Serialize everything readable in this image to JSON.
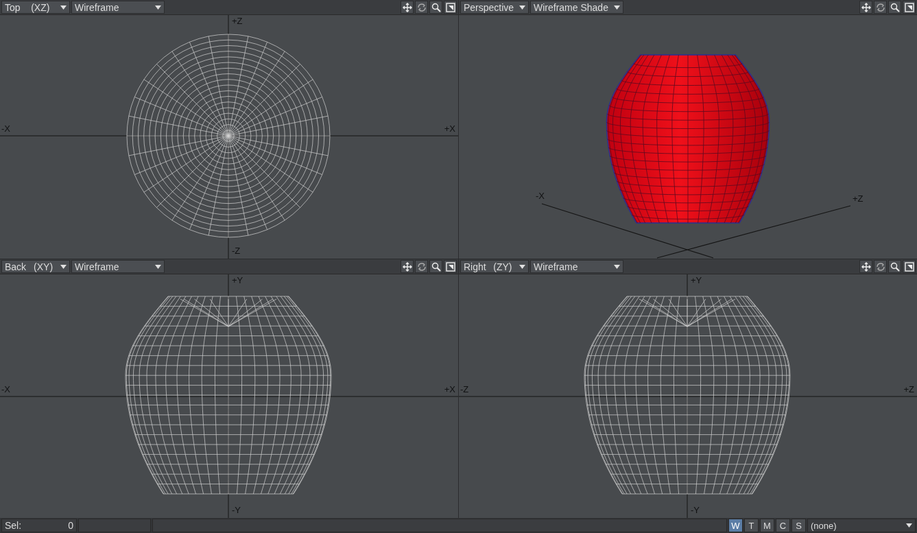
{
  "viewports": [
    {
      "view": "Top",
      "axes": "(XZ)",
      "mode": "Wireframe",
      "kind": "top",
      "axis_labels": [
        "+Z",
        "-Z",
        "-X",
        "+X"
      ]
    },
    {
      "view": "Perspective",
      "mode": "Wireframe Shade",
      "kind": "perspective",
      "axis_labels": [
        "-X",
        "+Z"
      ]
    },
    {
      "view": "Back",
      "axes": "(XY)",
      "mode": "Wireframe",
      "kind": "side",
      "axis_labels": [
        "+Y",
        "-Y",
        "-X",
        "+X"
      ]
    },
    {
      "view": "Right",
      "axes": "(ZY)",
      "mode": "Wireframe",
      "kind": "side",
      "axis_labels": [
        "+Y",
        "-Y",
        "-Z",
        "+Z"
      ]
    }
  ],
  "status_bar": {
    "selection_label": "Sel:",
    "selection_value": "0",
    "mode_buttons": [
      {
        "label": "W",
        "selected": true
      },
      {
        "label": "T",
        "selected": false
      },
      {
        "label": "M",
        "selected": false
      },
      {
        "label": "C",
        "selected": false
      },
      {
        "label": "S",
        "selected": false
      }
    ],
    "surface_dropdown": "(none)"
  }
}
